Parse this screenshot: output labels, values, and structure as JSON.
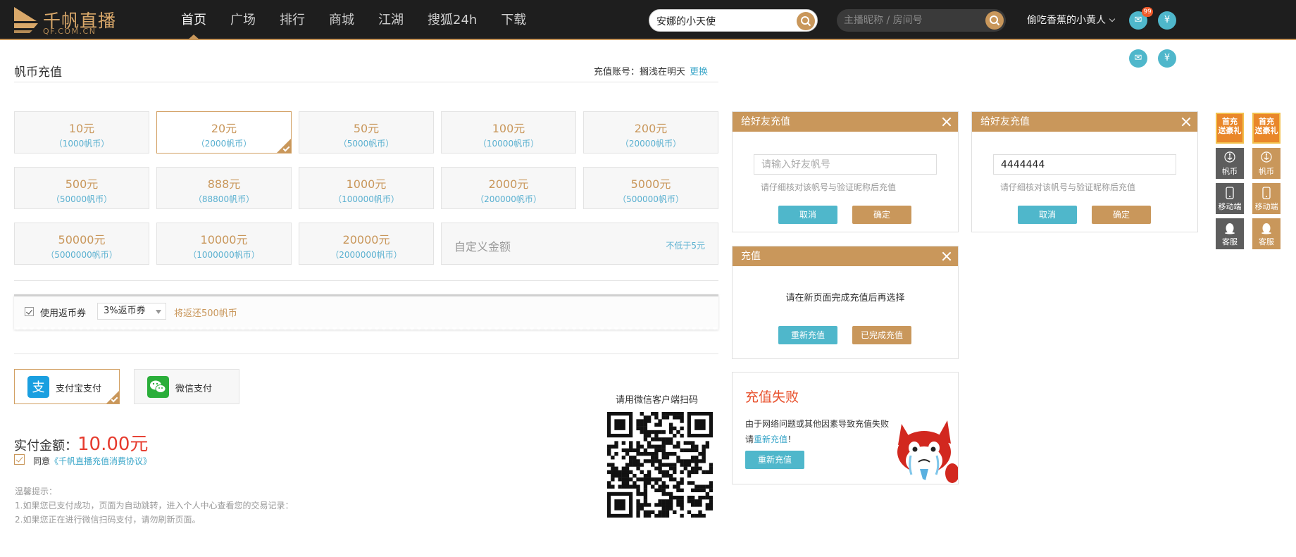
{
  "topbar": {
    "logo_title": "千帆直播",
    "logo_sub": "QF.COM.CN",
    "nav": [
      "首页",
      "广场",
      "排行",
      "商城",
      "江湖",
      "搜狐24h",
      "下载"
    ],
    "search_value": "安娜的小天使",
    "search2_placeholder": "主播昵称 / 房间号",
    "username": "偷吃香蕉的小黄人",
    "mail_badge": "99",
    "icons": {
      "mail": "mail-icon",
      "coin": "yuan-icon",
      "search": "search-icon"
    }
  },
  "recharge": {
    "title": "帆币充值",
    "account_label": "充值账号：",
    "account_name": "搁浅在明天",
    "switch": "更换",
    "amounts": [
      {
        "yuan": "10元",
        "coin": "（1000帆币）"
      },
      {
        "yuan": "20元",
        "coin": "（2000帆币）"
      },
      {
        "yuan": "50元",
        "coin": "（5000帆币）"
      },
      {
        "yuan": "100元",
        "coin": "（10000帆币）"
      },
      {
        "yuan": "200元",
        "coin": "（20000帆币）"
      },
      {
        "yuan": "500元",
        "coin": "（50000帆币）"
      },
      {
        "yuan": "888元",
        "coin": "（88800帆币）"
      },
      {
        "yuan": "1000元",
        "coin": "（100000帆币）"
      },
      {
        "yuan": "2000元",
        "coin": "（200000帆币）"
      },
      {
        "yuan": "5000元",
        "coin": "（500000帆币）"
      },
      {
        "yuan": "50000元",
        "coin": "（5000000帆币）"
      },
      {
        "yuan": "10000元",
        "coin": "（1000000帆币）"
      },
      {
        "yuan": "20000元",
        "coin": "（2000000帆币）"
      }
    ],
    "selected_amount": "20元",
    "custom_label": "自定义金额",
    "custom_min": "不低于5元",
    "coupon_use": "使用返币券",
    "coupon_select": "3%返币券",
    "coupon_rebate": "将返还500帆币",
    "pay_alipay": "支付宝支付",
    "pay_wechat": "微信支付",
    "actual_label": "实付金额：",
    "actual_value": "10.00元",
    "agree_prefix": "同意",
    "agree_link": "《千帆直播充值消费协议》",
    "tips_title": "温馨提示：",
    "tip1": "1.如果您已支付成功，页面为自动跳转，进入个人中心查看您的交易记录：",
    "tip2": "2.如果您正在进行微信扫码支付，请勿刷新页面。",
    "qr_title": "请用微信客户端扫码"
  },
  "dialogs": {
    "friend1": {
      "title": "给好友充值",
      "placeholder": "请输入好友帆号",
      "value": "",
      "hint": "请仔细核对该帆号与验证昵称后充值",
      "cancel": "取消",
      "confirm": "确定"
    },
    "friend2": {
      "title": "给好友充值",
      "placeholder": "请输入好友帆号",
      "value": "4444444",
      "hint": "请仔细核对该帆号与验证昵称后充值",
      "cancel": "取消",
      "confirm": "确定"
    },
    "recharge": {
      "title": "充值",
      "msg": "请在新页面完成充值后再选择",
      "retry": "重新充值",
      "done": "已完成充值"
    },
    "fail": {
      "title": "充值失败",
      "line1": "由于网络问题或其他因素导致充值失败",
      "line2_prefix": "请",
      "line2_link": "重新充值",
      "line2_suffix": "！",
      "button": "重新充值"
    }
  },
  "sidebar": {
    "gift": "首充送豪礼",
    "gift_line1": "首充",
    "gift_line2": "送豪礼",
    "coin": "帆币",
    "mobile": "移动端",
    "service": "客服"
  },
  "colors": {
    "gold": "#c9975b",
    "blue": "#4fb7cb",
    "red": "#e63b2e",
    "dark": "#1e1e1e"
  }
}
